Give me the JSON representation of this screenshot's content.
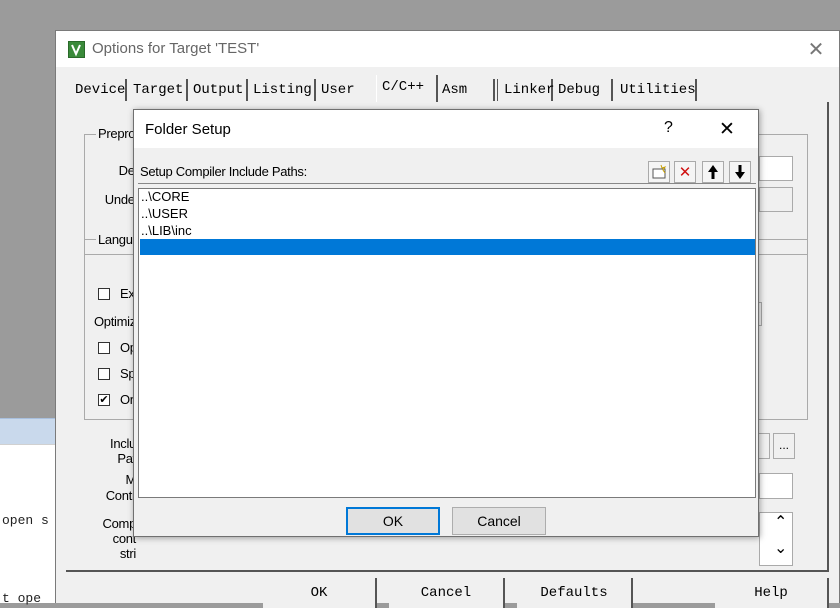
{
  "background": {
    "console_lines": [
      "open s",
      "t ope"
    ]
  },
  "main_window": {
    "title": "Options for Target 'TEST'",
    "close_glyph": "✕",
    "tabs": [
      "Device",
      "Target",
      "Output",
      "Listing",
      "User",
      "C/C++",
      "Asm",
      "Linker",
      "Debug",
      "Utilities"
    ],
    "active_tab": "C/C++",
    "preprocessor": {
      "group_label": "Prepro",
      "define_label": "Def",
      "undefine_label": "Undef"
    },
    "language": {
      "group_label": "Langu",
      "checkbox_ex_label": "Ex",
      "optimize_label": "Optimiz",
      "checkbox_op_label": "Op",
      "checkbox_sp_label": "Sp",
      "checkbox_on_label": "On",
      "checkbox_on_checked": "✔"
    },
    "include_label_1": "Inclu",
    "include_label_2": "Pat",
    "misc_label_1": "M",
    "misc_label_2": "Contr",
    "compiler_label_1": "Comp",
    "compiler_label_2": "cont",
    "compiler_label_3": "stri",
    "browse_button": "...",
    "scroll_up_glyph": "⌃",
    "scroll_down_glyph": "⌄",
    "buttons": {
      "ok": "OK",
      "cancel": "Cancel",
      "defaults": "Defaults",
      "help": "Help"
    }
  },
  "folder_setup": {
    "title": "Folder Setup",
    "help_glyph": "?",
    "close_glyph": "✕",
    "list_label": "Setup Compiler Include Paths:",
    "toolbar": {
      "new_icon": "new-folder-icon",
      "delete_icon": "delete-icon",
      "up_icon": "move-up-icon",
      "down_icon": "move-down-icon",
      "delete_glyph": "✕",
      "up_glyph": "🡅",
      "down_glyph": "🡇"
    },
    "paths": [
      "..\\CORE",
      "..\\USER",
      "..\\LIB\\inc"
    ],
    "selected_row_index": 3,
    "ok_label": "OK",
    "cancel_label": "Cancel",
    "colors": {
      "selection": "#0078d7",
      "delete_red": "#d01010"
    }
  }
}
